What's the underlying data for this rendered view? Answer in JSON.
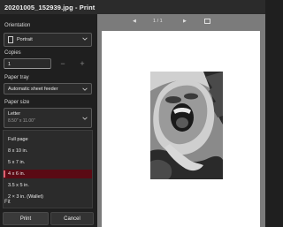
{
  "window": {
    "title": "20201005_152939.jpg - Print"
  },
  "orientation": {
    "label": "Orientation",
    "value": "Portrait",
    "icon": "portrait-page-icon"
  },
  "copies": {
    "label": "Copies",
    "value": "1",
    "decrement": "−",
    "increment": "+"
  },
  "paper_tray": {
    "label": "Paper tray",
    "value": "Automatic sheet feeder"
  },
  "paper_size": {
    "label": "Paper size",
    "value": "Letter",
    "dimensions": "8.50\" x 11.00\""
  },
  "photo_size_options": {
    "items": [
      "Full page",
      "8 x 10 in.",
      "5 x 7 in.",
      "4 x 6 in.",
      "3.5 x 5 in.",
      "2 × 3 in. (Wallet)"
    ],
    "selected": "4 x 6 in.",
    "selected_color": "#5a0a14"
  },
  "fit": {
    "label": "Fit"
  },
  "buttons": {
    "print": "Print",
    "cancel": "Cancel"
  },
  "preview": {
    "pager": {
      "prev": "◀",
      "pages": "1 / 1",
      "next": "▶"
    },
    "background": "#7b7b7b",
    "photo": "black-and-white-child-laughing-photo"
  }
}
